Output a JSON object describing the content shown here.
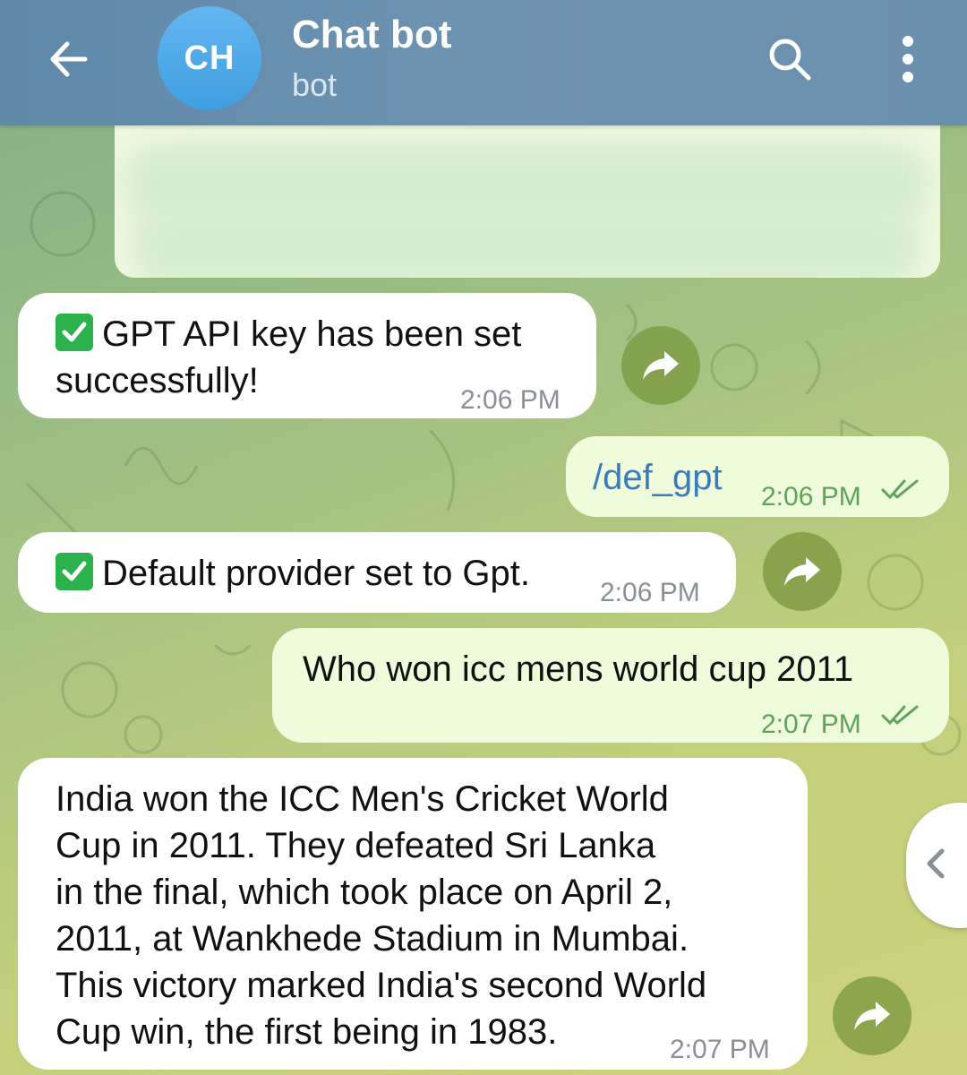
{
  "header": {
    "avatar_initials": "CH",
    "title": "Chat bot",
    "subtitle": "bot",
    "back_icon": "back-arrow-icon",
    "search_icon": "search-icon",
    "menu_icon": "more-vertical-icon"
  },
  "messages": [
    {
      "type": "incoming",
      "text_line1": "GPT API key has been set",
      "text_line2": "successfully!",
      "time": "2:06 PM",
      "has_check_icon": true
    },
    {
      "type": "outgoing",
      "text": "/def_gpt",
      "time": "2:06 PM",
      "status": "read"
    },
    {
      "type": "incoming",
      "text": "Default provider set to Gpt.",
      "time": "2:06 PM",
      "has_check_icon": true
    },
    {
      "type": "outgoing",
      "text": "Who won icc mens world cup 2011",
      "time": "2:07 PM",
      "status": "read"
    },
    {
      "type": "incoming",
      "lines": [
        "India won the ICC Men's Cricket World",
        "Cup in 2011. They defeated Sri Lanka",
        "in the final, which took place on April 2,",
        "2011, at Wankhede Stadium in Mumbai.",
        "This victory marked India's second World",
        "Cup win, the first being in 1983."
      ],
      "time": "2:07 PM"
    }
  ],
  "colors": {
    "header": "#6a8fae",
    "avatar": "#4ea9e8",
    "incoming_bubble": "#ffffff",
    "outgoing_bubble": "#effcdc",
    "outgoing_text": "#3a7bbf",
    "read_ticks": "#5fa35a",
    "check_icon": "#2bb24c"
  }
}
